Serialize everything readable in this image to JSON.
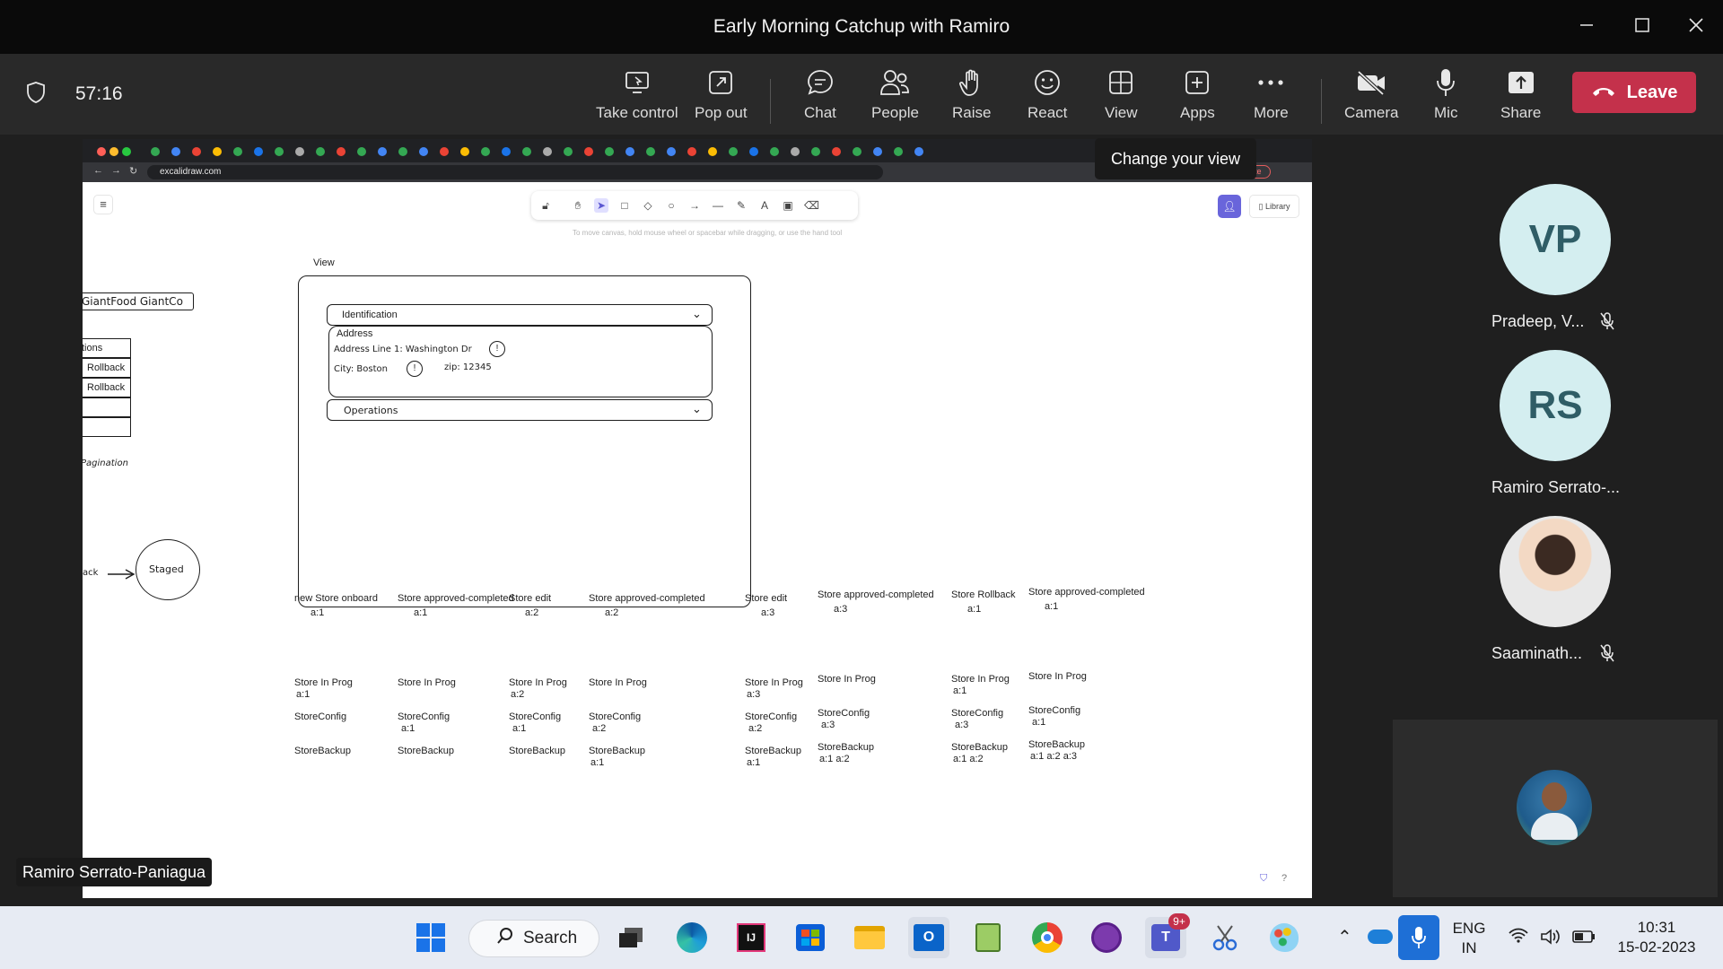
{
  "window": {
    "title": "Early Morning Catchup with Ramiro"
  },
  "meeting": {
    "timer": "57:16",
    "buttons": {
      "take_control": "Take control",
      "pop_out": "Pop out",
      "chat": "Chat",
      "people": "People",
      "raise": "Raise",
      "react": "React",
      "view": "View",
      "apps": "Apps",
      "more": "More",
      "camera": "Camera",
      "mic": "Mic",
      "share": "Share",
      "leave": "Leave"
    },
    "tooltip": "Change your view",
    "presenter_label": "Ramiro Serrato-Paniagua",
    "participants": [
      {
        "initials": "VP",
        "name": "Pradeep, V...",
        "muted": true
      },
      {
        "initials": "RS",
        "name": "Ramiro Serrato-...",
        "muted": false
      },
      {
        "initials": "",
        "name": "Saaminath...",
        "muted": true
      }
    ]
  },
  "browser": {
    "url": "excalidraw.com",
    "update_label": "Update"
  },
  "excalidraw": {
    "library_label": "Library",
    "hint": "To move canvas, hold mouse wheel or spacebar while dragging, or use the hand tool",
    "left_title": "GiantFood GiantCo",
    "left_table": [
      "tions",
      "Rollback",
      "Rollback",
      "",
      ""
    ],
    "pagination": "Pagination",
    "staged": "Staged",
    "ack": "ack",
    "view_label": "View",
    "identification": "Identification",
    "address_title": "Address",
    "address_line": "Address Line 1: Washington Dr",
    "city": "City: Boston",
    "zip": "zip: 12345",
    "operations": "Operations",
    "columns": [
      {
        "head": "new Store onboard",
        "head_sub": "a:1",
        "inprog": "Store In Prog",
        "inprog_sub": "a:1",
        "config": "StoreConfig",
        "config_sub": "",
        "backup": "StoreBackup",
        "backup_sub": ""
      },
      {
        "head": "Store approved-completed",
        "head_sub": "a:1",
        "inprog": "Store In Prog",
        "inprog_sub": "",
        "config": "StoreConfig",
        "config_sub": "a:1",
        "backup": "StoreBackup",
        "backup_sub": ""
      },
      {
        "head": "Store edit",
        "head_sub": "a:2",
        "inprog": "Store In Prog",
        "inprog_sub": "a:2",
        "config": "StoreConfig",
        "config_sub": "a:1",
        "backup": "StoreBackup",
        "backup_sub": ""
      },
      {
        "head": "Store approved-completed",
        "head_sub": "a:2",
        "inprog": "Store In Prog",
        "inprog_sub": "",
        "config": "StoreConfig",
        "config_sub": "a:2",
        "backup": "StoreBackup",
        "backup_sub": "a:1"
      },
      {
        "head": "Store edit",
        "head_sub": "a:3",
        "inprog": "Store In Prog",
        "inprog_sub": "a:3",
        "config": "StoreConfig",
        "config_sub": "a:2",
        "backup": "StoreBackup",
        "backup_sub": "a:1"
      },
      {
        "head": "Store approved-completed",
        "head_sub": "a:3",
        "inprog": "Store In Prog",
        "inprog_sub": "",
        "config": "StoreConfig",
        "config_sub": "a:3",
        "backup": "StoreBackup",
        "backup_sub": "a:1  a:2"
      },
      {
        "head": "Store Rollback",
        "head_sub": "a:1",
        "inprog": "Store In Prog",
        "inprog_sub": "a:1",
        "config": "StoreConfig",
        "config_sub": "a:3",
        "backup": "StoreBackup",
        "backup_sub": "a:1  a:2"
      },
      {
        "head": "Store approved-completed",
        "head_sub": "a:1",
        "inprog": "Store In Prog",
        "inprog_sub": "",
        "config": "StoreConfig",
        "config_sub": "a:1",
        "backup": "StoreBackup",
        "backup_sub": "a:1  a:2  a:3"
      }
    ]
  },
  "taskbar": {
    "search": "Search",
    "teams_badge": "9+",
    "lang_1": "ENG",
    "lang_2": "IN",
    "time": "10:31",
    "date": "15-02-2023"
  },
  "colors": {
    "leave": "#c4314b",
    "accent": "#6965db"
  }
}
